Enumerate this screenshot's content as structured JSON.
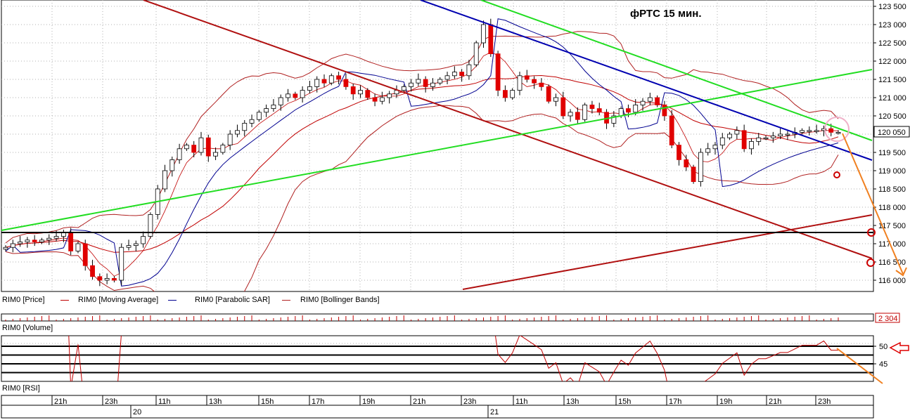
{
  "chart_data": [
    {
      "type": "candlestick",
      "title": "фРТС   15 мин.",
      "instrument": "RIM0",
      "ylim": [
        115750,
        123500
      ],
      "y_ticks": [
        "123 500",
        "123 000",
        "122 500",
        "122 000",
        "121 500",
        "121 000",
        "120 500",
        "120 000",
        "119 500",
        "119 000",
        "118 500",
        "118 000",
        "117 500",
        "117 000",
        "116 500",
        "116 000"
      ],
      "last_price_label": "120 050",
      "x_ticks": [
        "21h",
        "23h",
        "20",
        "11h",
        "13h",
        "15h",
        "17h",
        "19h",
        "21h",
        "23h",
        "21",
        "11h",
        "13h",
        "15h",
        "17h",
        "19h",
        "21h",
        "23h"
      ],
      "series_names": [
        "RIM0 [Price]",
        "RIM0 [Moving Average]",
        "RIM0 [Parabolic SAR]",
        "RIM0 [Bollinger Bands]"
      ],
      "approx_closes": [
        116900,
        117000,
        117050,
        117100,
        117050,
        117100,
        117150,
        117200,
        117300,
        116800,
        117000,
        116400,
        116100,
        116000,
        116050,
        116000,
        116900,
        116950,
        117000,
        117200,
        117800,
        118500,
        119000,
        119300,
        119600,
        119700,
        119500,
        119900,
        119400,
        119500,
        119700,
        120000,
        120100,
        120300,
        120400,
        120600,
        120700,
        120800,
        121000,
        121100,
        121000,
        121200,
        121300,
        121500,
        121400,
        121600,
        121500,
        121300,
        121100,
        121200,
        121000,
        120900,
        121000,
        121100,
        121200,
        121300,
        121400,
        121500,
        121300,
        121400,
        121500,
        121600,
        121700,
        121600,
        121900,
        122500,
        123000,
        122200,
        121200,
        121000,
        121200,
        121600,
        121500,
        121400,
        121300,
        120900,
        121000,
        120500,
        120600,
        120400,
        120800,
        120700,
        120600,
        120300,
        120500,
        120700,
        120600,
        120800,
        120900,
        121000,
        120800,
        120500,
        119700,
        119300,
        119100,
        118700,
        119500,
        119600,
        119700,
        119900,
        120000,
        120100,
        119600,
        119800,
        119900,
        119900,
        119950,
        120000,
        120000,
        120050,
        120100,
        120100,
        120100,
        120150,
        120050,
        120050
      ],
      "rsi": {
        "label": "RIM0 [RSI]",
        "ticks": [
          "50",
          "45"
        ]
      },
      "volume": {
        "label": "RIM0 [Volume]",
        "last_label": "2 304"
      }
    }
  ],
  "colors": {
    "up_candle": "#ffffff",
    "down_candle": "#e00000",
    "moving_average": "#c00000",
    "bollinger": "#b02020",
    "parabolic_sar": "#000090",
    "green_channel": "#22dd22",
    "blue_trend": "#0000b0",
    "red_channel": "#b01010",
    "forecast_arrow": "#f08020",
    "marker_circle": "#cc0000"
  }
}
